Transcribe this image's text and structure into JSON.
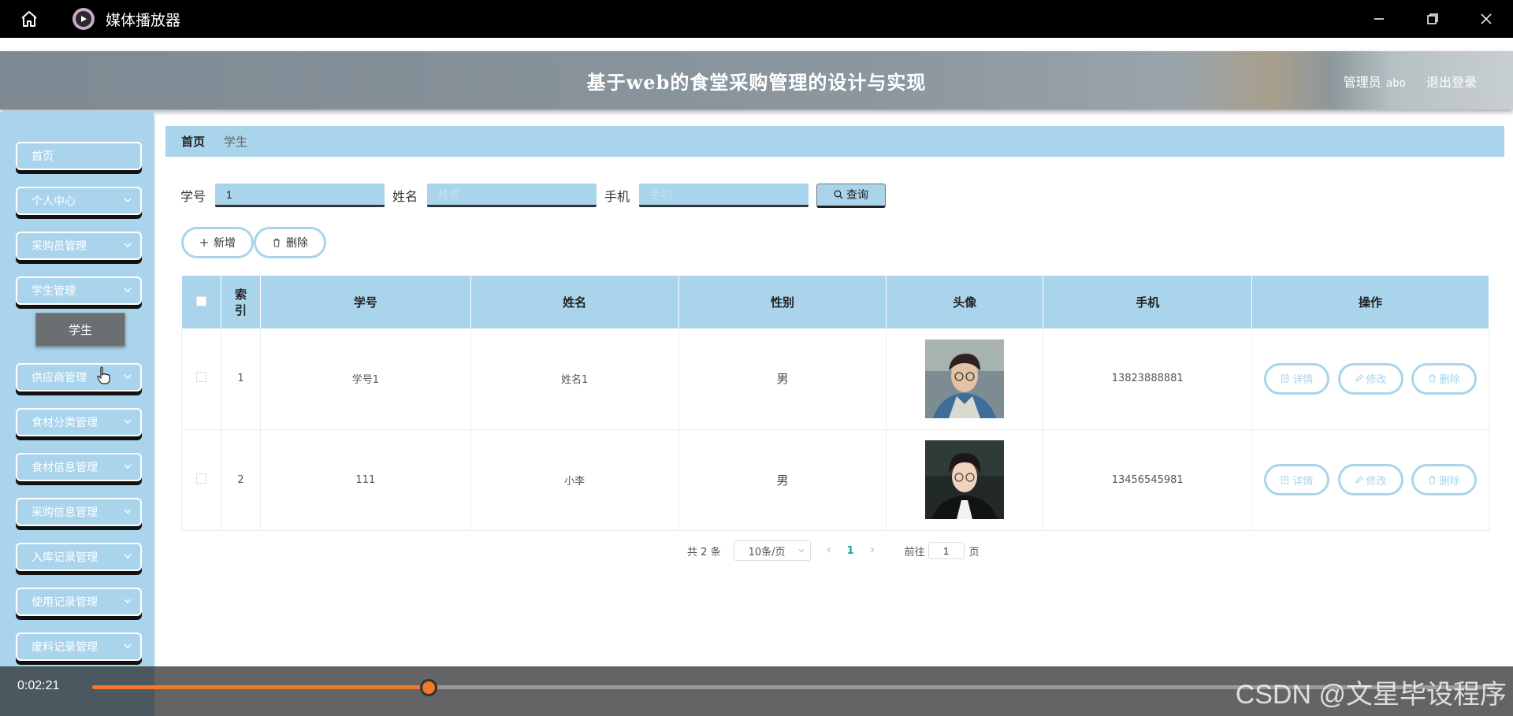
{
  "player": {
    "title": "媒体播放器",
    "time": "0:02:21",
    "progress_fraction": 0.24,
    "watermark": "CSDN @文星毕设程序",
    "accent_color": "#f07a2a"
  },
  "header": {
    "title": "基于web的食堂采购管理的设计与实现",
    "role": "管理员",
    "username": "abo",
    "logout": "退出登录",
    "theme_color": "#a9d4ec"
  },
  "sidebar": {
    "items": [
      {
        "label": "首页",
        "has_chevron": false
      },
      {
        "label": "个人中心",
        "has_chevron": true
      },
      {
        "label": "采购员管理",
        "has_chevron": true
      },
      {
        "label": "学生管理",
        "has_chevron": true
      },
      {
        "label": "供应商管理",
        "has_chevron": true
      },
      {
        "label": "食材分类管理",
        "has_chevron": true
      },
      {
        "label": "食材信息管理",
        "has_chevron": true
      },
      {
        "label": "采购信息管理",
        "has_chevron": true
      },
      {
        "label": "入库记录管理",
        "has_chevron": true
      },
      {
        "label": "使用记录管理",
        "has_chevron": true
      },
      {
        "label": "废料记录管理",
        "has_chevron": true
      }
    ],
    "submenu_active": "学生"
  },
  "breadcrumb": {
    "home": "首页",
    "current": "学生"
  },
  "search": {
    "student_no_label": "学号",
    "student_no_value": "1",
    "name_label": "姓名",
    "name_placeholder": "姓名",
    "phone_label": "手机",
    "phone_placeholder": "手机",
    "query_button": "查询"
  },
  "actions": {
    "add": "新增",
    "delete": "删除"
  },
  "table": {
    "columns": [
      "索引",
      "学号",
      "姓名",
      "性别",
      "头像",
      "手机",
      "操作"
    ],
    "rows": [
      {
        "index": "1",
        "student_no": "学号1",
        "name": "姓名1",
        "gender": "男",
        "phone": "13823888881"
      },
      {
        "index": "2",
        "student_no": "111",
        "name": "小李",
        "gender": "男",
        "phone": "13456545981"
      }
    ],
    "ops": {
      "detail": "详情",
      "edit": "修改",
      "delete": "删除"
    }
  },
  "pagination": {
    "total_prefix": "共",
    "total": "2",
    "total_suffix": "条",
    "page_size": "10条/页",
    "current_page": "1",
    "goto_label": "前往",
    "goto_value": "1",
    "page_suffix": "页"
  }
}
